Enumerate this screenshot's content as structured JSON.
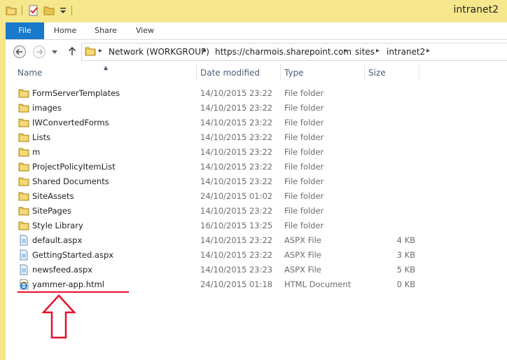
{
  "window": {
    "title": "intranet2"
  },
  "ribbon": {
    "tabs": [
      "File",
      "Home",
      "Share",
      "View"
    ]
  },
  "address": {
    "crumbs": [
      "Network (WORKGROUP)",
      "https://charmois.sharepoint.com",
      "sites",
      "intranet2"
    ]
  },
  "columns": {
    "name": "Name",
    "date": "Date modified",
    "type": "Type",
    "size": "Size"
  },
  "files": [
    {
      "name": "FormServerTemplates",
      "date": "14/10/2015 23:22",
      "type": "File folder",
      "size": "",
      "icon": "folder-icon"
    },
    {
      "name": "images",
      "date": "14/10/2015 23:22",
      "type": "File folder",
      "size": "",
      "icon": "folder-icon"
    },
    {
      "name": "IWConvertedForms",
      "date": "14/10/2015 23:22",
      "type": "File folder",
      "size": "",
      "icon": "folder-icon"
    },
    {
      "name": "Lists",
      "date": "14/10/2015 23:22",
      "type": "File folder",
      "size": "",
      "icon": "folder-icon"
    },
    {
      "name": "m",
      "date": "14/10/2015 23:22",
      "type": "File folder",
      "size": "",
      "icon": "folder-icon"
    },
    {
      "name": "ProjectPolicyItemList",
      "date": "14/10/2015 23:22",
      "type": "File folder",
      "size": "",
      "icon": "folder-icon"
    },
    {
      "name": "Shared Documents",
      "date": "14/10/2015 23:22",
      "type": "File folder",
      "size": "",
      "icon": "folder-icon"
    },
    {
      "name": "SiteAssets",
      "date": "24/10/2015 01:02",
      "type": "File folder",
      "size": "",
      "icon": "folder-icon"
    },
    {
      "name": "SitePages",
      "date": "14/10/2015 23:22",
      "type": "File folder",
      "size": "",
      "icon": "folder-icon"
    },
    {
      "name": "Style Library",
      "date": "16/10/2015 13:25",
      "type": "File folder",
      "size": "",
      "icon": "folder-icon"
    },
    {
      "name": "default.aspx",
      "date": "14/10/2015 23:22",
      "type": "ASPX File",
      "size": "4 KB",
      "icon": "aspx-file-icon"
    },
    {
      "name": "GettingStarted.aspx",
      "date": "14/10/2015 23:22",
      "type": "ASPX File",
      "size": "3 KB",
      "icon": "aspx-file-icon"
    },
    {
      "name": "newsfeed.aspx",
      "date": "14/10/2015 23:23",
      "type": "ASPX File",
      "size": "5 KB",
      "icon": "aspx-file-icon"
    },
    {
      "name": "yammer-app.html",
      "date": "24/10/2015 01:18",
      "type": "HTML Document",
      "size": "0 KB",
      "icon": "ie-html-icon"
    }
  ],
  "colors": {
    "titlebar": "#f6e78c",
    "file_tab": "#1979ca",
    "annotation": "#e8102a"
  }
}
